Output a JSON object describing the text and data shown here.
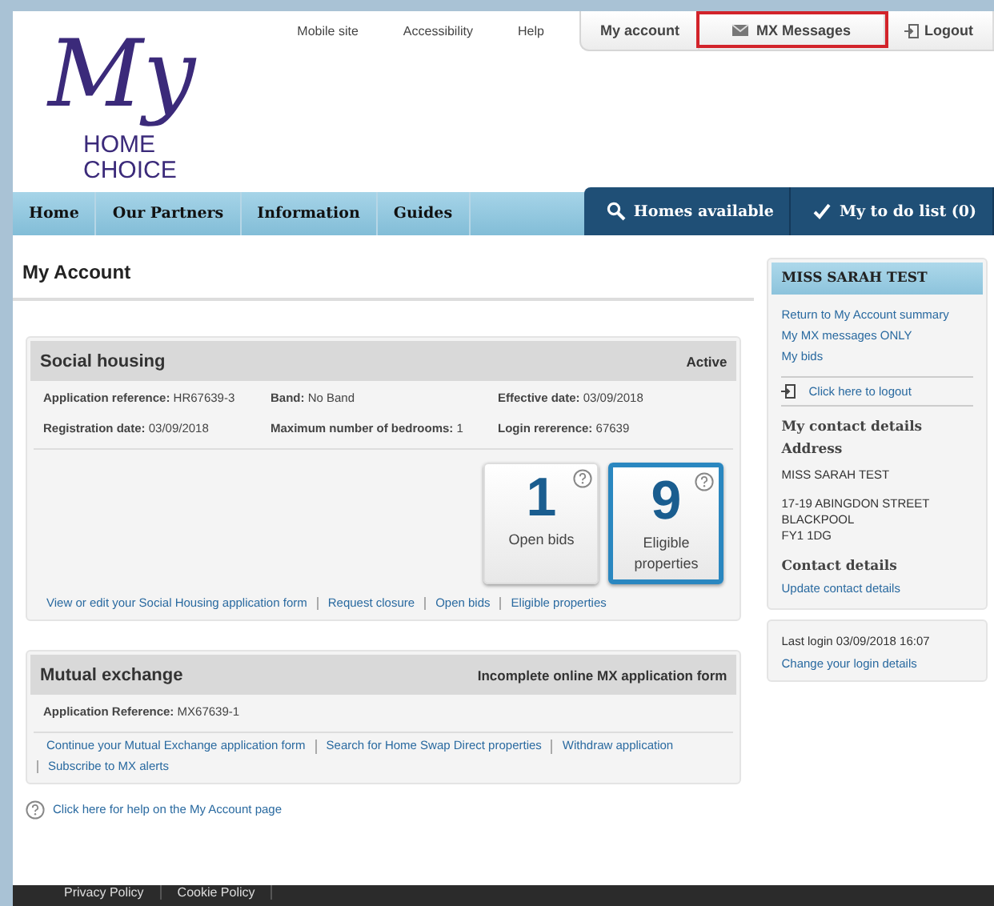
{
  "logo": {
    "script": "My",
    "lines": [
      "HOME",
      "CHOICE"
    ]
  },
  "top_links": [
    "Mobile site",
    "Accessibility",
    "Help"
  ],
  "account_tabs": [
    {
      "label": "My account",
      "highlighted": false
    },
    {
      "label": "MX Messages",
      "highlighted": true
    },
    {
      "label": "Logout",
      "highlighted": false
    }
  ],
  "nav": {
    "items": [
      "Home",
      "Our Partners",
      "Information",
      "Guides"
    ],
    "actions": [
      "Homes available",
      "My to do list (0)"
    ]
  },
  "page_title": "My Account",
  "social_housing": {
    "title": "Social housing",
    "status": "Active",
    "details": [
      "**Application reference:** HR67639-3",
      "**Band:** No Band",
      "**Effective date:** 03/09/2018",
      "**Registration date:** 03/09/2018",
      "**Maximum number of bedrooms:** 1",
      "**Login rererence:** 67639"
    ],
    "stats": [
      {
        "number": "1",
        "label": "Open bids",
        "selected": false
      },
      {
        "number": "9",
        "label": "Eligible properties",
        "selected": true
      }
    ],
    "links": [
      "View or edit your Social Housing application form",
      "Request closure",
      "Open bids",
      "Eligible properties"
    ]
  },
  "mutual_exchange": {
    "title": "Mutual exchange",
    "status": "Incomplete online MX application form",
    "details": [
      "**Application Reference:** MX67639-1"
    ],
    "links": [
      "Continue your Mutual Exchange application form",
      "Search for Home Swap Direct properties",
      "Withdraw application",
      "Subscribe to MX alerts"
    ]
  },
  "help_link": "Click here for help on the My Account page",
  "profile": {
    "name": "MISS SARAH TEST",
    "links": [
      "Return to My Account summary",
      "My MX messages ONLY",
      "My bids"
    ],
    "logout": "Click here to logout",
    "contact_heading": "My contact details",
    "address_heading": "Address",
    "address_name": "MISS SARAH TEST",
    "address_lines": [
      "17-19 ABINGDON STREET",
      "BLACKPOOL",
      "FY1 1DG"
    ],
    "contact_details_heading": "Contact details",
    "update_link": "Update contact details"
  },
  "login": {
    "last_login": "Last login 03/09/2018 16:07",
    "change_link": "Change your login details"
  },
  "footer": [
    "Privacy Policy",
    "Cookie Policy"
  ]
}
